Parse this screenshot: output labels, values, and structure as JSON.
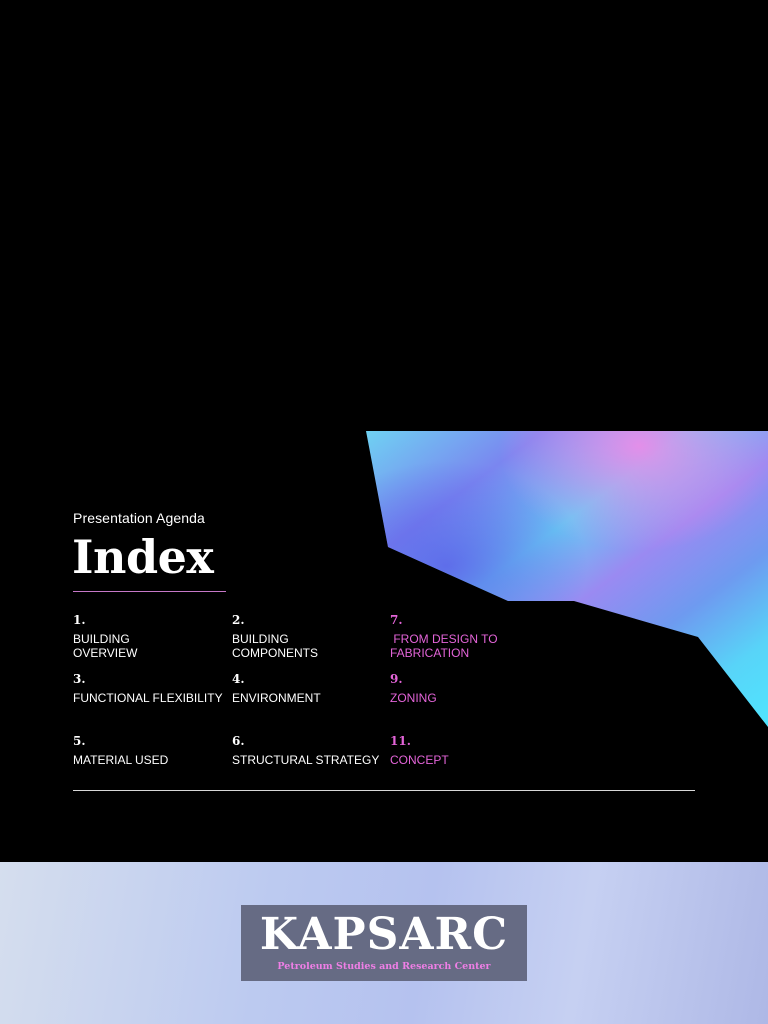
{
  "agenda": {
    "subtitle": "Presentation Agenda",
    "title": "Index"
  },
  "items": [
    {
      "number": "1.",
      "label": "BUILDING\nOVERVIEW",
      "accent": false
    },
    {
      "number": "2.",
      "label": "BUILDING\nCOMPONENTS",
      "accent": false
    },
    {
      "number": "7.",
      "label": " FROM DESIGN TO\nFABRICATION",
      "accent": true
    },
    {
      "number": "3.",
      "label": "FUNCTIONAL FLEXIBILITY",
      "accent": false
    },
    {
      "number": "4.",
      "label": "ENVIRONMENT",
      "accent": false
    },
    {
      "number": "9.",
      "label": "ZONING",
      "accent": true
    },
    {
      "number": "5.",
      "label": "MATERIAL USED",
      "accent": false
    },
    {
      "number": "6.",
      "label": "STRUCTURAL STRATEGY",
      "accent": false
    },
    {
      "number": "11.",
      "label": "CONCEPT",
      "accent": true
    }
  ],
  "logo": {
    "name": "KAPSARC",
    "tagline": "Petroleum Studies and Research Center"
  },
  "colors": {
    "background": "#000000",
    "accent": "#e364d8",
    "logo_box": "#666b84"
  }
}
